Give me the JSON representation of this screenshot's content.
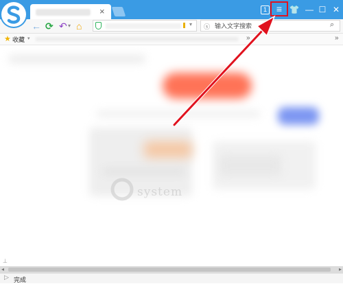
{
  "toolbar": {
    "tab_close": "×",
    "badge": "1",
    "menu": "≡",
    "skin": "👕",
    "minimize": "—",
    "maximize": "☐",
    "close": "✕"
  },
  "nav": {
    "back": "←",
    "reload": "⟳",
    "undo": "↶",
    "dropdown": "▾",
    "home": "⌂",
    "search_placeholder": "输入文字搜索",
    "search_icon": "⌕"
  },
  "bookmarks": {
    "star": "★",
    "label": "收藏",
    "caret": "▾",
    "more": "»"
  },
  "page": {
    "watermark": "system"
  },
  "scrollbar": {
    "left": "◂",
    "right": "▸",
    "mark": "⊥"
  },
  "status": {
    "icon": "▷",
    "text": "完成"
  },
  "colors": {
    "titlebar": "#3a9be4",
    "highlight": "#e0121e",
    "arrow": "#e0121e"
  },
  "icons": [
    "sogou-logo-icon",
    "close-icon",
    "menu-icon",
    "skin-icon",
    "minimize-icon",
    "maximize-icon",
    "back-icon",
    "reload-icon",
    "undo-icon",
    "home-icon",
    "shield-icon",
    "search-icon",
    "star-icon"
  ]
}
